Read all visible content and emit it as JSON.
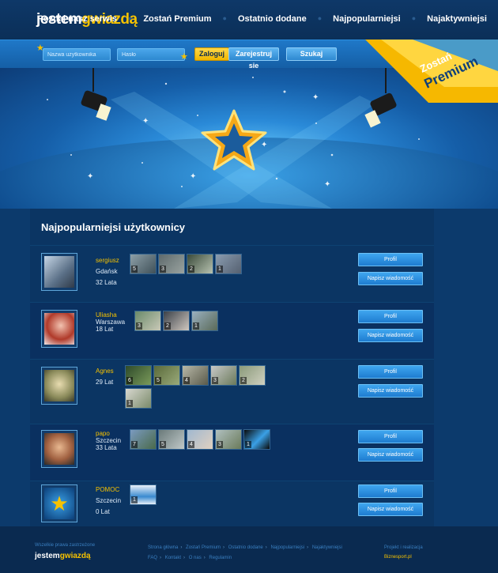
{
  "header": {
    "logo_part1": "jestem",
    "logo_part2": "gwiazdą",
    "nav": [
      {
        "label": "Poznaj nasz serwis"
      },
      {
        "label": "Zostań Premium"
      },
      {
        "label": "Ostatnio dodane"
      },
      {
        "label": "Najpopularniejsi"
      },
      {
        "label": "Najaktywniejsi"
      }
    ]
  },
  "login": {
    "username_placeholder": "Nazwa użytkownika",
    "password_placeholder": "Hasło",
    "login_label": "Zaloguj",
    "register_label": "Zarejestruj się",
    "search_label": "Szukaj"
  },
  "premium_badge": {
    "line1": "Zostań",
    "line2": "Premium"
  },
  "main": {
    "title": "Najpopularniejsi użytkownicy",
    "profile_label": "Profil",
    "message_label": "Napisz wiadomość",
    "users": [
      {
        "name": "sergiusz",
        "city": "Gdańsk",
        "age": "32 Lata",
        "photos": [
          "5",
          "3",
          "2",
          "1"
        ]
      },
      {
        "name": "Uliasha",
        "city": "Warszawa",
        "age": "18 Lat",
        "photos": [
          "3",
          "2",
          "1"
        ]
      },
      {
        "name": "Agnes",
        "city": "",
        "age": "29 Lat",
        "photos": [
          "6",
          "5",
          "4",
          "3",
          "2",
          "1"
        ]
      },
      {
        "name": "papo",
        "city": "Szczecin",
        "age": "33 Lata",
        "photos": [
          "7",
          "5",
          "4",
          "3",
          "1"
        ]
      },
      {
        "name": "POMOC",
        "city": "Szczecin",
        "age": "0 Lat",
        "photos": [
          "1"
        ]
      }
    ]
  },
  "footer": {
    "rights": "Wszelkie prawa zastrzeżone",
    "logo_part1": "jestem",
    "logo_part2": "gwiazdą",
    "links_row1": [
      "Strona główna",
      "Zostań Premium",
      "Ostatnio dodane",
      "Najpopularniejsi",
      "Najaktywniejsi"
    ],
    "links_row2": [
      "FAQ",
      "Kontakt",
      "O nas",
      "Regulamin"
    ],
    "credit_label": "Projekt i realizacja",
    "credit_brand": "Biznesport.pl"
  },
  "colors": {
    "accent": "#f6c200",
    "primary_blue": "#1e7cd0",
    "background": "#0a2a50"
  }
}
